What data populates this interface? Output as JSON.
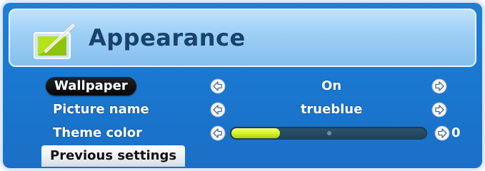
{
  "header": {
    "title": "Appearance",
    "icon": "appearance-icon"
  },
  "settings": [
    {
      "label": "Wallpaper",
      "value": "On",
      "selected": true
    },
    {
      "label": "Picture name",
      "value": "trueblue",
      "selected": false
    },
    {
      "label": "Theme color",
      "value": "0",
      "slider_level": 0.25,
      "selected": false
    }
  ],
  "footer": {
    "previous_settings": "Previous settings"
  },
  "colors": {
    "background": "#1a78d0",
    "header": "#9fd0f5",
    "title": "#18426f",
    "slider_fill": "#d4f21d"
  },
  "icons": {
    "left_arrow": "left-arrow-icon",
    "right_arrow": "right-arrow-icon"
  }
}
